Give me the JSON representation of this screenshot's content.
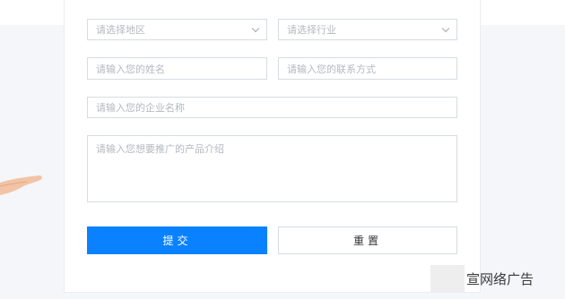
{
  "form": {
    "region_placeholder": "请选择地区",
    "industry_placeholder": "请选择行业",
    "name_placeholder": "请输入您的姓名",
    "contact_placeholder": "请输入您的联系方式",
    "company_placeholder": "请输入您的企业名称",
    "product_placeholder": "请输入您想要推广的产品介绍",
    "submit_label": "提交",
    "reset_label": "重置"
  },
  "watermark": {
    "text": "宣网络广告"
  },
  "colors": {
    "primary": "#0a82ff",
    "border": "#d7dce2",
    "placeholder": "#b4b9bf"
  },
  "icons": {
    "select_arrow": "chevron-down-icon"
  }
}
